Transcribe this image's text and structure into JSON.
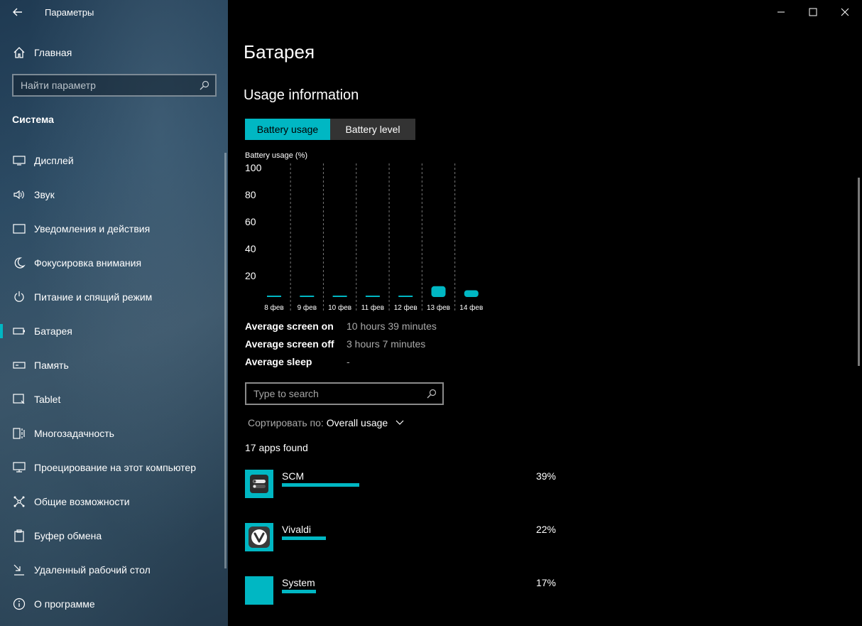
{
  "window": {
    "app_title": "Параметры",
    "page_title": "Батарея"
  },
  "sidebar": {
    "home_label": "Главная",
    "search_placeholder": "Найти параметр",
    "section_title": "Система",
    "items": [
      {
        "label": "Дисплей",
        "icon": "display-icon"
      },
      {
        "label": "Звук",
        "icon": "speaker-icon"
      },
      {
        "label": "Уведомления и действия",
        "icon": "notification-icon"
      },
      {
        "label": "Фокусировка внимания",
        "icon": "moon-icon"
      },
      {
        "label": "Питание и спящий режим",
        "icon": "power-icon"
      },
      {
        "label": "Батарея",
        "icon": "battery-icon",
        "active": true
      },
      {
        "label": "Память",
        "icon": "storage-icon"
      },
      {
        "label": "Tablet",
        "icon": "tablet-icon"
      },
      {
        "label": "Многозадачность",
        "icon": "multitasking-icon"
      },
      {
        "label": "Проецирование на этот компьютер",
        "icon": "projecting-icon"
      },
      {
        "label": "Общие возможности",
        "icon": "shared-experiences-icon"
      },
      {
        "label": "Буфер обмена",
        "icon": "clipboard-icon"
      },
      {
        "label": "Удаленный рабочий стол",
        "icon": "remote-desktop-icon"
      },
      {
        "label": "О программе",
        "icon": "info-icon"
      }
    ]
  },
  "usage": {
    "title": "Usage information",
    "tabs": {
      "usage": "Battery usage",
      "level": "Battery level"
    },
    "stats": [
      {
        "label": "Average screen on",
        "value": "10 hours 39 minutes"
      },
      {
        "label": "Average screen off",
        "value": "3 hours 7 minutes"
      },
      {
        "label": "Average sleep",
        "value": "-"
      }
    ],
    "search_placeholder": "Type to search",
    "sort_label": "Сортировать по:",
    "sort_value": "Overall usage",
    "apps_found": "17 apps found",
    "apps": [
      {
        "name": "SCM",
        "percent": "39%",
        "fraction": 0.39,
        "icon": "scm-icon"
      },
      {
        "name": "Vivaldi",
        "percent": "22%",
        "fraction": 0.22,
        "icon": "vivaldi-icon"
      },
      {
        "name": "System",
        "percent": "17%",
        "fraction": 0.17,
        "icon": "system-icon"
      }
    ]
  },
  "colors": {
    "accent": "#00b7c3",
    "tab_inactive": "#333333"
  },
  "chart_data": {
    "type": "bar",
    "ylabel": "Battery usage (%)",
    "ylim": [
      0,
      100
    ],
    "yticks": [
      20,
      40,
      60,
      80,
      100
    ],
    "categories": [
      "8 фев",
      "9 фев",
      "10 фев",
      "11 фев",
      "12 фев",
      "13 фев",
      "14 фев"
    ],
    "values": [
      0.5,
      0.5,
      0.5,
      0.5,
      0.5,
      8,
      5
    ],
    "grid": "vertical dashed"
  }
}
